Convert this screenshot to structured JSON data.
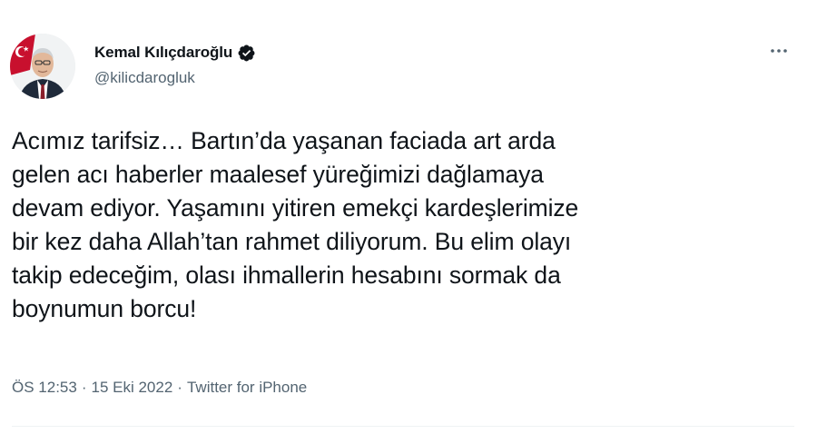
{
  "author": {
    "display_name": "Kemal Kılıçdaroğlu",
    "handle": "@kilicdarogluk",
    "verified": true,
    "avatar_icon": "profile-photo"
  },
  "actions": {
    "more_icon": "more-horizontal-icon"
  },
  "tweet": {
    "text": "Acımız tarifsiz… Bartın’da yaşanan faciada art arda\ngelen acı haberler maalesef yüreğimizi dağlamaya\ndevam ediyor. Yaşamını yitiren emekçi kardeşlerimize\nbir kez daha Allah’tan rahmet diliyorum. Bu elim olayı\ntakip edeceğim, olası ihmallerin hesabını sormak da\nboynumun borcu!",
    "time": "ÖS 12:53",
    "date": "15 Eki 2022",
    "separator": "·",
    "source": "Twitter for iPhone"
  },
  "colors": {
    "text": "#0f1419",
    "secondary": "#536471",
    "verified_badge": "#1d9bf0",
    "divider": "#eff3f4"
  }
}
